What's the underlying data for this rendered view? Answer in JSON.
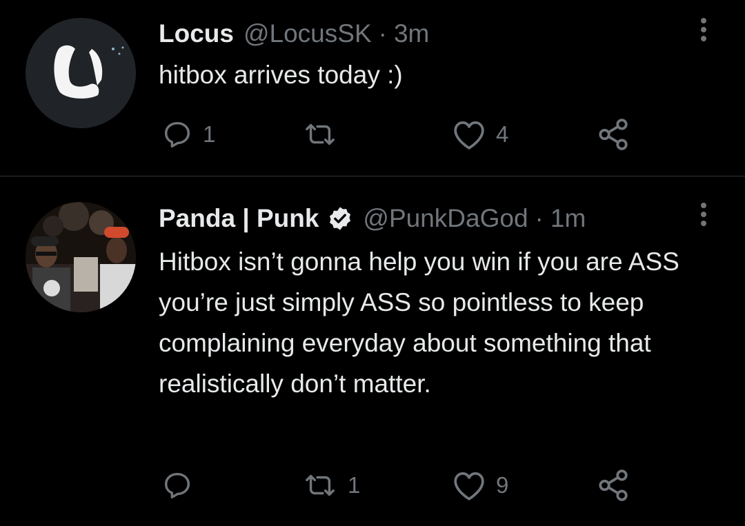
{
  "tweets": [
    {
      "display_name": "Locus",
      "handle": "@LocusSK",
      "separator": "·",
      "time": "3m",
      "text": "hitbox arrives today :)",
      "reply_count": "1",
      "retweet_count": "",
      "like_count": "4",
      "verified": false
    },
    {
      "display_name": "Panda | Punk",
      "handle": "@PunkDaGod",
      "separator": "·",
      "time": "1m",
      "text": "Hitbox isn’t gonna help you win if you are ASS you’re just simply ASS so pointless to keep complaining everyday about something that realistically don’t matter.",
      "reply_count": "",
      "retweet_count": "1",
      "like_count": "9",
      "verified": true
    }
  ],
  "colors": {
    "background": "#000000",
    "text_primary": "#e7e9ea",
    "text_secondary": "#71767b",
    "divider": "#2f3336"
  },
  "icons": [
    "avatar",
    "more-icon",
    "reply-icon",
    "retweet-icon",
    "like-icon",
    "share-icon",
    "verified-badge-icon"
  ]
}
